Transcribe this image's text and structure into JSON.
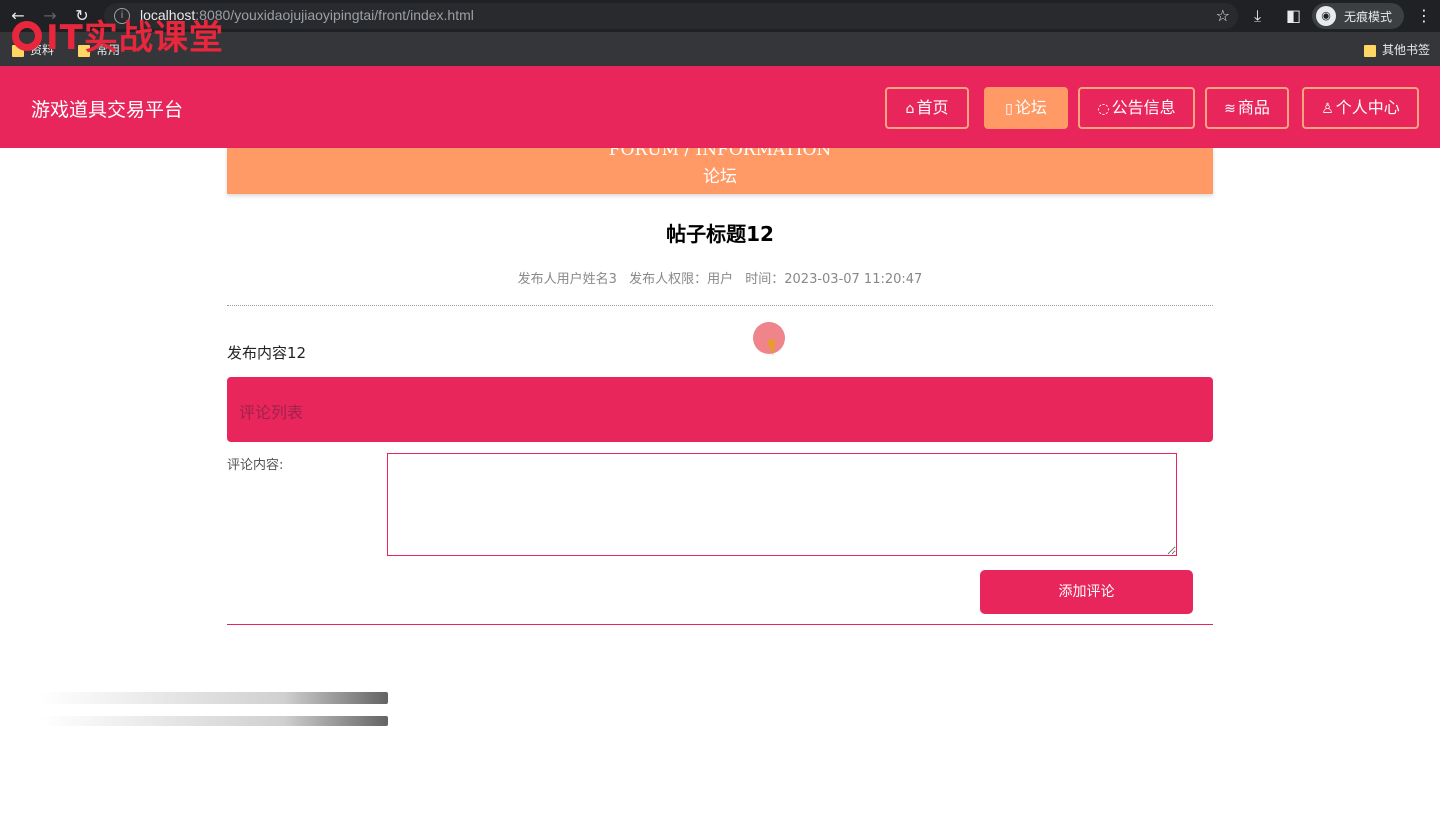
{
  "browser": {
    "url_host": "localhost",
    "url_rest": ":8080/youxidaojujiaoyipingtai/front/index.html",
    "incognito_label": "无痕模式",
    "bookmarks": [
      "资料",
      "常用"
    ],
    "other_bookmarks": "其他书签"
  },
  "watermark": "IT实战课堂",
  "header": {
    "site_title": "游戏道具交易平台",
    "nav": [
      {
        "label": "首页",
        "icon": "home-icon",
        "active": false
      },
      {
        "label": "论坛",
        "icon": "forum-icon",
        "active": true
      },
      {
        "label": "公告信息",
        "icon": "notice-icon",
        "active": false
      },
      {
        "label": "商品",
        "icon": "layers-icon",
        "active": false
      },
      {
        "label": "个人中心",
        "icon": "user-icon",
        "active": false
      }
    ]
  },
  "banner": {
    "en": "FORUM / INFORMATION",
    "cn": "论坛"
  },
  "post": {
    "title": "帖子标题12",
    "author": "发布人用户姓名3",
    "role": "发布人权限：用户",
    "time": "时间：2023-03-07 11:20:47",
    "content": "发布内容12"
  },
  "comments": {
    "header": "评论列表",
    "field_label": "评论内容:",
    "submit_label": "添加评论"
  },
  "colors": {
    "primary": "#e8265b",
    "accent": "#ff9966"
  }
}
